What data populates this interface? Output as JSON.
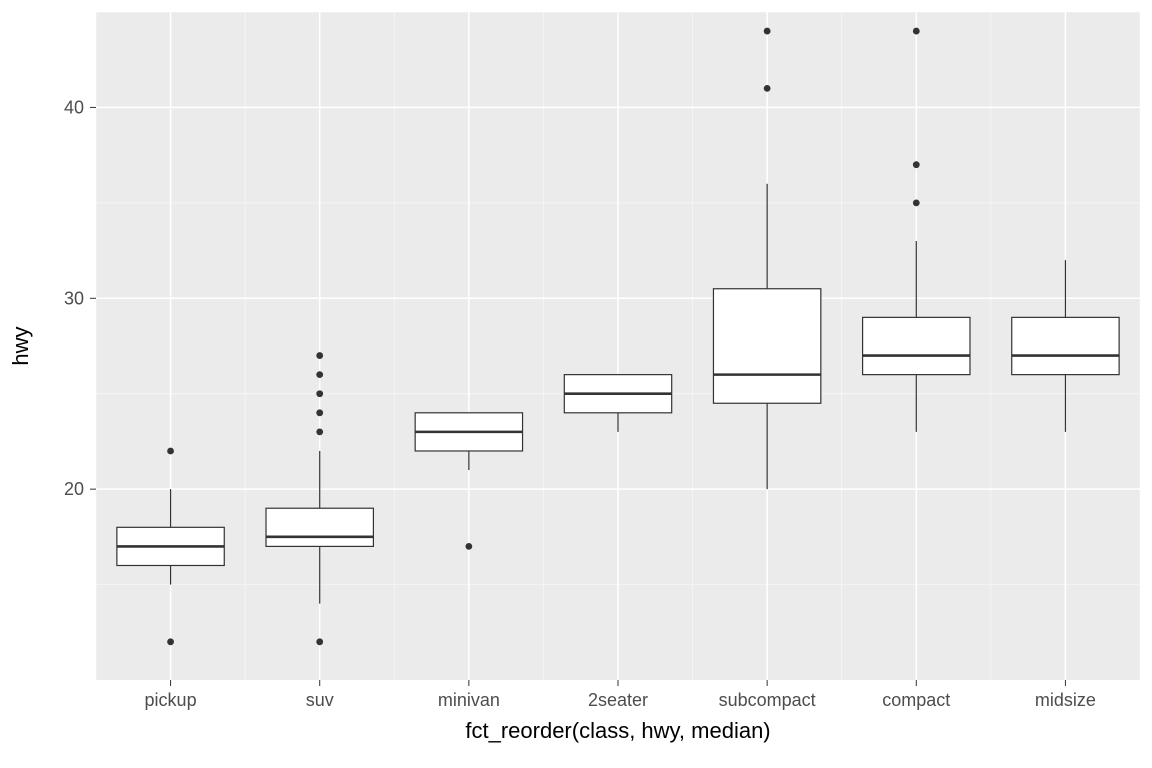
{
  "chart_data": {
    "type": "boxplot",
    "xlabel": "fct_reorder(class, hwy, median)",
    "ylabel": "hwy",
    "ylim": [
      10,
      45
    ],
    "y_ticks": [
      20,
      30,
      40
    ],
    "categories": [
      "pickup",
      "suv",
      "minivan",
      "2seater",
      "subcompact",
      "compact",
      "midsize"
    ],
    "series": [
      {
        "name": "pickup",
        "min": 15,
        "q1": 16,
        "median": 17,
        "q3": 18,
        "max": 20,
        "outliers": [
          12,
          22
        ]
      },
      {
        "name": "suv",
        "min": 14,
        "q1": 17,
        "median": 17.5,
        "q3": 19,
        "max": 22,
        "outliers": [
          12,
          23,
          24,
          25,
          26,
          27
        ]
      },
      {
        "name": "minivan",
        "min": 21,
        "q1": 22,
        "median": 23,
        "q3": 24,
        "max": 24,
        "outliers": [
          17
        ]
      },
      {
        "name": "2seater",
        "min": 23,
        "q1": 24,
        "median": 25,
        "q3": 26,
        "max": 26,
        "outliers": []
      },
      {
        "name": "subcompact",
        "min": 20,
        "q1": 24.5,
        "median": 26,
        "q3": 30.5,
        "max": 36,
        "outliers": [
          41,
          44
        ]
      },
      {
        "name": "compact",
        "min": 23,
        "q1": 26,
        "median": 27,
        "q3": 29,
        "max": 33,
        "outliers": [
          35,
          37,
          44
        ]
      },
      {
        "name": "midsize",
        "min": 23,
        "q1": 26,
        "median": 27,
        "q3": 29,
        "max": 32,
        "outliers": []
      }
    ]
  }
}
